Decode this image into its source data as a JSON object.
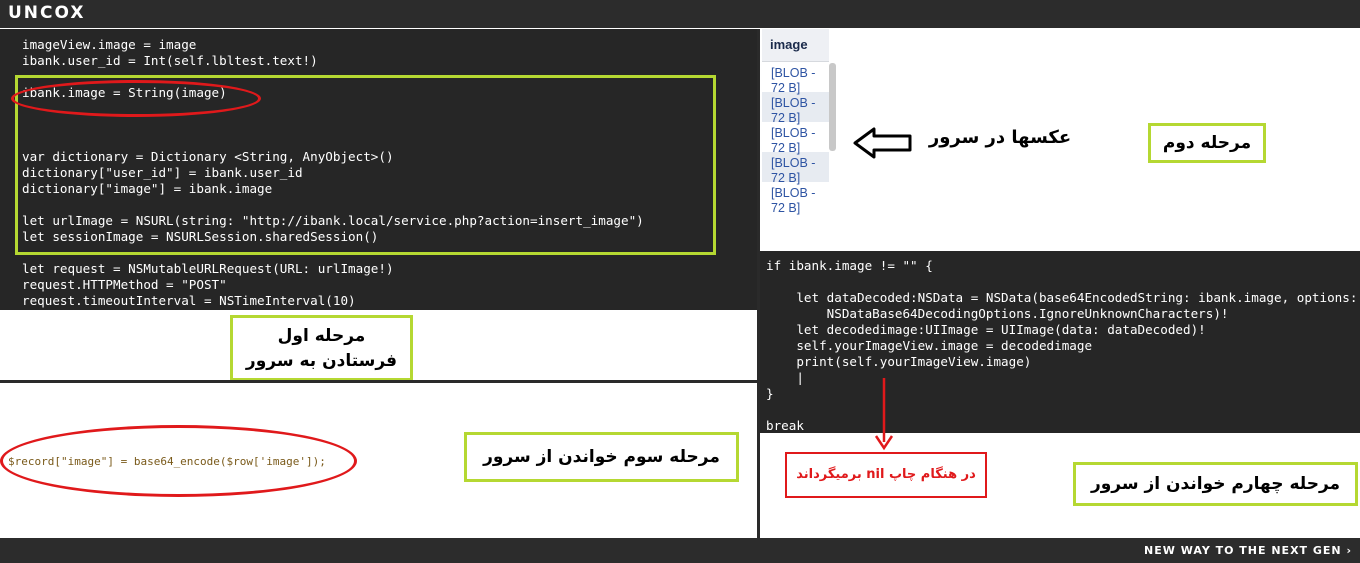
{
  "header": {
    "logo": "UNCOX"
  },
  "footer": {
    "slogan": "NEW WAY TO THE NEXT GEN ›"
  },
  "step1": {
    "code_lines": [
      "imageView.image = image",
      "ibank.user_id = Int(self.lbltest.text!)",
      "",
      "ibank.image = String(image)",
      "",
      "",
      "",
      "var dictionary = Dictionary <String, AnyObject>()",
      "dictionary[\"user_id\"] = ibank.user_id",
      "dictionary[\"image\"] = ibank.image",
      "",
      "let urlImage = NSURL(string: \"http://ibank.local/service.php?action=insert_image\")",
      "let sessionImage = NSURLSession.sharedSession()",
      "",
      "let request = NSMutableURLRequest(URL: urlImage!)",
      "request.HTTPMethod = \"POST\"",
      "request.timeoutInterval = NSTimeInterval(10)"
    ],
    "label_line1": "مرحله اول",
    "label_line2": "فرستادن به سرور"
  },
  "step2": {
    "table_header": "image",
    "rows": [
      "[BLOB - 72 B]",
      "[BLOB - 72 B]",
      "[BLOB - 72 B]",
      "[BLOB - 72 B]",
      "[BLOB - 72 B]"
    ],
    "caption": "عکسها در سرور",
    "label": "مرحله دوم",
    "arrow_icon": "arrow-left-outline"
  },
  "step3": {
    "php_code": "$record[\"image\"] = base64_encode($row['image']);",
    "label": "مرحله سوم خواندن از سرور"
  },
  "step4": {
    "code_lines": [
      "if ibank.image != \"\" {",
      "",
      "    let dataDecoded:NSData = NSData(base64EncodedString: ibank.image, options:",
      "        NSDataBase64DecodingOptions.IgnoreUnknownCharacters)!",
      "    let decodedimage:UIImage = UIImage(data: dataDecoded)!",
      "    self.yourImageView.image = decodedimage",
      "    print(self.yourImageView.image)",
      "    |",
      "}",
      "",
      "break"
    ],
    "note": "در هنگام چاپ nil برمیگرداند",
    "label": "مرحله چهارم خواندن از سرور"
  },
  "colors": {
    "green_frame": "#b5d832",
    "red_mark": "#e0191b",
    "code_bg": "#262626",
    "link_blue": "#2e54a3"
  }
}
